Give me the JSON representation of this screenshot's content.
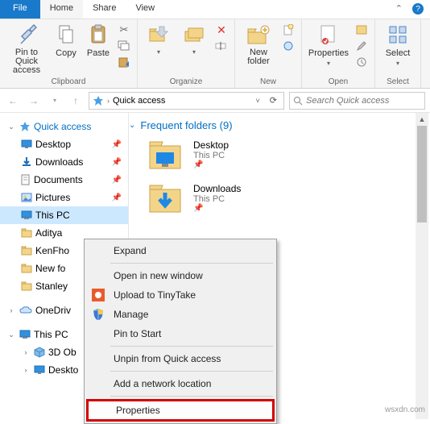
{
  "tabs": {
    "file": "File",
    "home": "Home",
    "share": "Share",
    "view": "View"
  },
  "ribbon": {
    "clipboard": {
      "label": "Clipboard",
      "pin": "Pin to Quick\naccess",
      "copy": "Copy",
      "paste": "Paste"
    },
    "organize": {
      "label": "Organize"
    },
    "new": {
      "label": "New",
      "newfolder": "New\nfolder"
    },
    "open": {
      "label": "Open",
      "properties": "Properties"
    },
    "select": {
      "label": "Select",
      "select": "Select"
    }
  },
  "address": {
    "path": "Quick access",
    "search_placeholder": "Search Quick access"
  },
  "sidebar": {
    "quick_access": "Quick access",
    "items": [
      {
        "label": "Desktop"
      },
      {
        "label": "Downloads"
      },
      {
        "label": "Documents"
      },
      {
        "label": "Pictures"
      },
      {
        "label": "This PC"
      },
      {
        "label": "Aditya"
      },
      {
        "label": "KenFho"
      },
      {
        "label": "New fo"
      },
      {
        "label": "Stanley"
      }
    ],
    "onedrive": "OneDriv",
    "this_pc": "This PC",
    "pc_children": [
      {
        "label": "3D Ob"
      },
      {
        "label": "Deskto"
      }
    ]
  },
  "main": {
    "header": "Frequent folders (9)",
    "folders": [
      {
        "name": "Desktop",
        "loc": "This PC"
      },
      {
        "name": "Downloads",
        "loc": "This PC"
      }
    ]
  },
  "context_menu": {
    "expand": "Expand",
    "open_win": "Open in new window",
    "upload": "Upload to TinyTake",
    "manage": "Manage",
    "pin": "Pin to Start",
    "unpin": "Unpin from Quick access",
    "add_net": "Add a network location",
    "props": "Properties"
  },
  "watermark": "wsxdn.com"
}
